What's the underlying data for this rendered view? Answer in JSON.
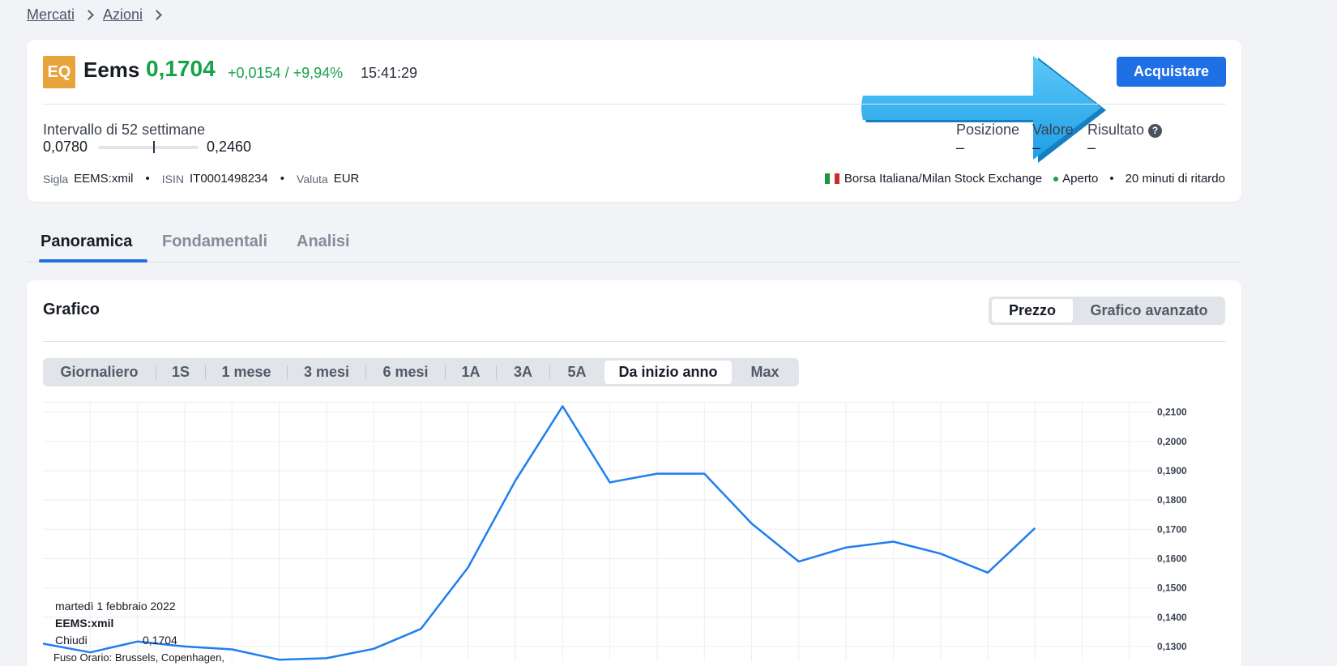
{
  "breadcrumb": {
    "items": [
      "Mercati",
      "Azioni"
    ]
  },
  "stock": {
    "badge": "EQ",
    "name": "Eems",
    "price": "0,1704",
    "change": "+0,0154 / +9,94%",
    "time": "15:41:29",
    "buy_label": "Acquistare",
    "range_label": "Intervallo di 52 settimane",
    "range_low": "0,0780",
    "range_high": "0,2460",
    "range_position": 0.55,
    "meta": [
      {
        "key": "Sigla",
        "value": "EEMS:xmil"
      },
      {
        "key": "ISIN",
        "value": "IT0001498234"
      },
      {
        "key": "Valuta",
        "value": "EUR"
      }
    ],
    "position": {
      "label": "Posizione",
      "value": "–"
    },
    "value": {
      "label": "Valore",
      "value": "–"
    },
    "result": {
      "label": "Risultato",
      "value": "–",
      "help": "?"
    },
    "exchange": "Borsa Italiana/Milan Stock Exchange",
    "status": "Aperto",
    "delay": "20 minuti di ritardo",
    "dot": "•"
  },
  "tabs": [
    "Panoramica",
    "Fondamentali",
    "Analisi"
  ],
  "active_tab": 0,
  "chart_section": {
    "title": "Grafico",
    "modes": [
      "Prezzo",
      "Grafico avanzato"
    ],
    "active_mode": 0,
    "periods": [
      "Giornaliero",
      "1S",
      "1 mese",
      "3 mesi",
      "6 mesi",
      "1A",
      "3A",
      "5A",
      "Da inizio anno",
      "Max"
    ],
    "active_period": 8
  },
  "tooltip": {
    "date": "martedì 1 febbraio 2022",
    "symbol": "EEMS:xmil",
    "label": "Chiudi",
    "value": "0,1704",
    "timezone": "Fuso Orario: Brussels, Copenhagen, Madrid, Paris"
  },
  "colors": {
    "accent": "#1f6fe5",
    "up": "#15a34a",
    "badge": "#e8a33a",
    "line": "#1e7ef0"
  },
  "chart_data": {
    "type": "line",
    "x": [
      1,
      2,
      3,
      4,
      5,
      6,
      7,
      8,
      9,
      10,
      11,
      12,
      13,
      14,
      15,
      16,
      17,
      18,
      19,
      20,
      21,
      22
    ],
    "values": [
      0.131,
      0.128,
      0.1317,
      0.13,
      0.129,
      0.1255,
      0.126,
      0.1292,
      0.136,
      0.157,
      0.1866,
      0.212,
      0.186,
      0.189,
      0.189,
      0.172,
      0.159,
      0.1638,
      0.1658,
      0.1617,
      0.1552,
      0.1704
    ],
    "y_ticks": [
      "0,2100",
      "0,2000",
      "0,1900",
      "0,1800",
      "0,1700",
      "0,1600",
      "0,1500",
      "0,1400",
      "0,1300"
    ],
    "y_tick_values": [
      0.21,
      0.2,
      0.19,
      0.18,
      0.17,
      0.16,
      0.15,
      0.14,
      0.13
    ],
    "ylim": [
      0.125,
      0.2135
    ],
    "grid": true
  }
}
